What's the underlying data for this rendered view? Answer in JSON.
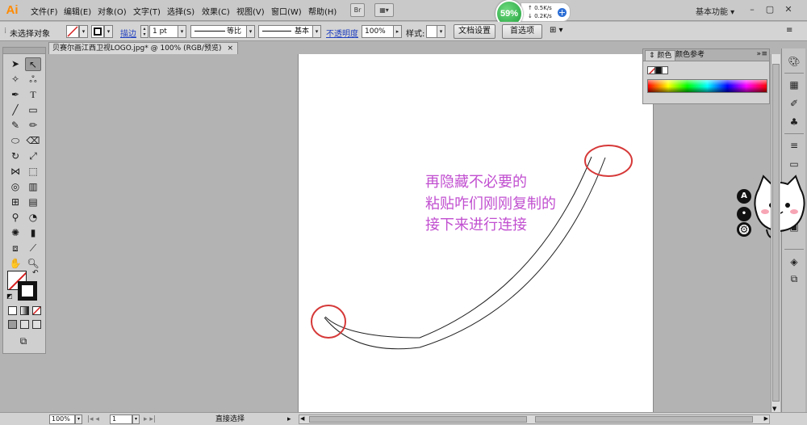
{
  "app": {
    "logo": "Ai"
  },
  "menu": [
    {
      "label": "文件(F)"
    },
    {
      "label": "编辑(E)"
    },
    {
      "label": "对象(O)"
    },
    {
      "label": "文字(T)"
    },
    {
      "label": "选择(S)"
    },
    {
      "label": "效果(C)"
    },
    {
      "label": "视图(V)"
    },
    {
      "label": "窗口(W)"
    },
    {
      "label": "帮助(H)"
    }
  ],
  "menubar_buttons": {
    "bridge": "Br"
  },
  "network": {
    "percent": "59%",
    "up": "0.5K/s",
    "down": "0.2K/s"
  },
  "workspace": {
    "label": "基本功能"
  },
  "control": {
    "selection_status": "未选择对象",
    "stroke_link": "描边",
    "stroke_weight": "1 pt",
    "profile": "等比",
    "brush": "基本",
    "opacity_link": "不透明度",
    "opacity_value": "100%",
    "style_label": "样式:",
    "doc_setup": "文档设置",
    "preferences": "首选项"
  },
  "document_tab": {
    "title": "贝赛尔画江西卫视LOGO.jpg* @ 100% (RGB/预览)",
    "close": "×"
  },
  "color_panel": {
    "tabs": [
      "颜色",
      "颜色参考"
    ],
    "collapse": "»"
  },
  "canvas": {
    "annotation_lines": [
      "再隐藏不必要的",
      "粘贴咋们刚刚复制的",
      "接下来进行连接"
    ],
    "highlight_color": "#d63838",
    "text_color": "#c14fd0"
  },
  "status": {
    "zoom": "100%",
    "artboard": "1",
    "tool": "直接选择"
  },
  "colors": {
    "accent_orange": "#ff8a00",
    "network_green": "#1f9e3a",
    "link_blue": "#1f3fbf"
  }
}
